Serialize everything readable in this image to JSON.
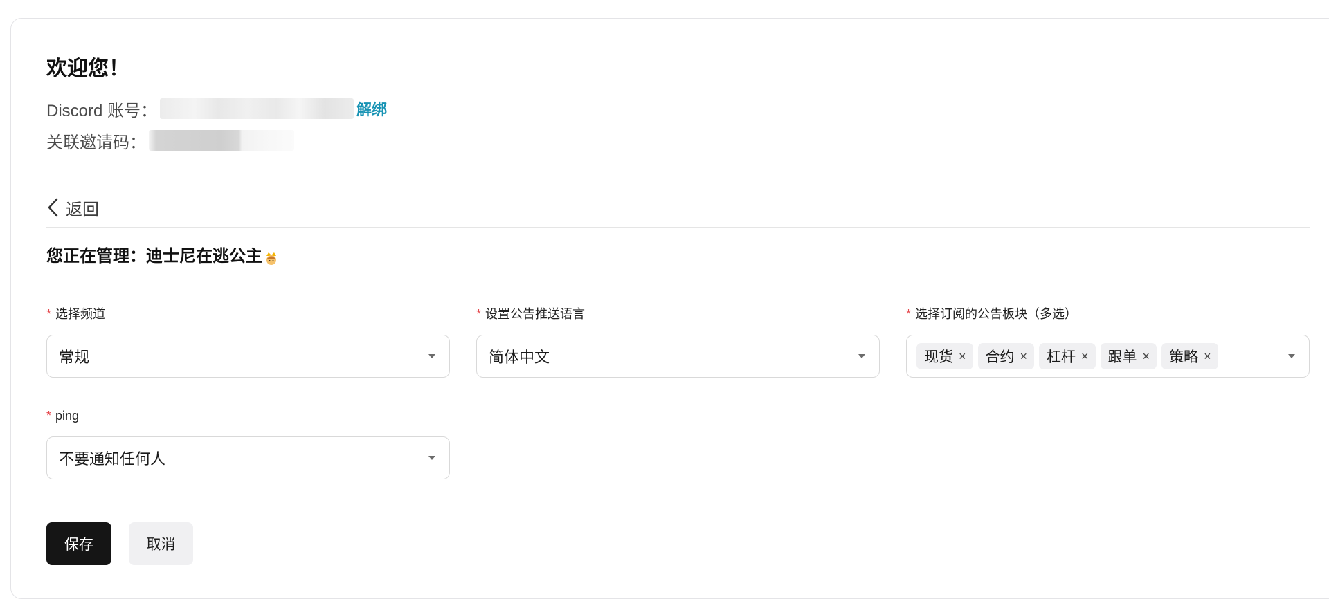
{
  "welcome": {
    "title": "欢迎您！",
    "discord_label": "Discord 账号：",
    "unbind_label": "解绑",
    "invite_label": "关联邀请码："
  },
  "nav": {
    "back_label": "返回"
  },
  "manage": {
    "title": "您正在管理：迪士尼在逃公主",
    "icon": "princess-emoji"
  },
  "form": {
    "required_mark": "*",
    "channel": {
      "label": "选择频道",
      "value": "常规"
    },
    "language": {
      "label": "设置公告推送语言",
      "value": "简体中文"
    },
    "sections": {
      "label": "选择订阅的公告板块（多选）",
      "tags": [
        "现货",
        "合约",
        "杠杆",
        "跟单",
        "策略"
      ],
      "remove_glyph": "×"
    },
    "ping": {
      "label": "ping",
      "value": "不要通知任何人"
    }
  },
  "actions": {
    "save_label": "保存",
    "cancel_label": "取消"
  },
  "colors": {
    "link": "#1793b4",
    "required": "#e5484d",
    "primary_button": "#151515",
    "secondary_button": "#f0f0f2"
  }
}
